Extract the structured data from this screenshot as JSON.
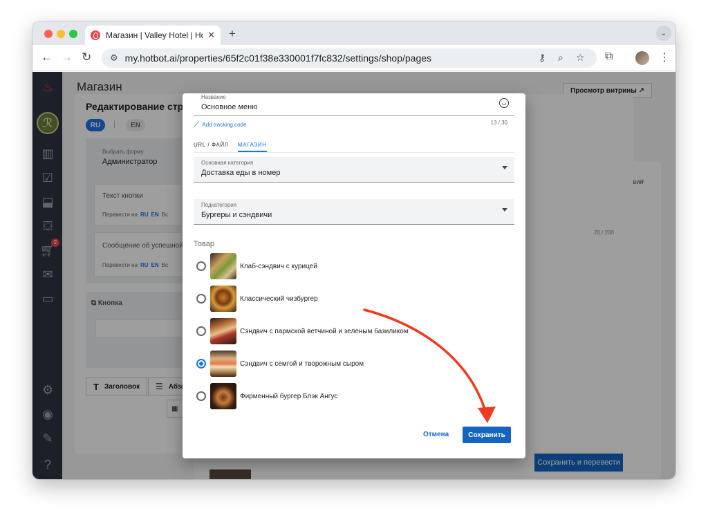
{
  "browser": {
    "tab_title": "Магазин | Valley Hotel | Hotbot",
    "url": "my.hotbot.ai/properties/65f2c01f38e330001f7fc832/settings/shop/pages",
    "accent": "#1a73e8"
  },
  "page": {
    "title": "Магазин",
    "preview_button": "Просмотр витрины ↗"
  },
  "sidebar": {
    "cart_badge": "2",
    "icons": [
      "hotbot-logo-icon",
      "valley-hotel-icon",
      "analytics-icon",
      "tasks-icon",
      "inbox-icon",
      "concierge-icon",
      "cart-icon",
      "mail-icon",
      "chat-icon",
      "settings-icon",
      "profile-icon",
      "edit-icon",
      "help-icon"
    ]
  },
  "edit_panel": {
    "title": "Редактирование стра",
    "lang_ru": "RU",
    "lang_en": "EN",
    "form_select_label": "Выбрать форму",
    "form_select_value": "Администратор",
    "button_text_label": "Текст кнопки",
    "translate_to": "Перевести на",
    "translate_ru": "RU",
    "translate_en": "EN",
    "translate_more": "Вс",
    "success_message_label": "Сообщение об успешной",
    "button_section_label": "Кнопка",
    "heading_button": "Заголовок",
    "paragraph_button": "Абза",
    "save_translate_button": "Сохранить и перевести"
  },
  "background": {
    "column_label": "ствия",
    "counter": "20 / 200"
  },
  "modal": {
    "name_label": "Название",
    "name_value": "Основное меню",
    "tracking_link": "Add tracking code",
    "char_counter": "13 / 30",
    "tabs": [
      "URL / ФАЙЛ",
      "МАГАЗИН"
    ],
    "active_tab": "МАГАЗИН",
    "main_category_label": "Основная категория",
    "main_category_value": "Доставка еды в номер",
    "subcategory_label": "Подкатегория",
    "subcategory_value": "Бургеры и сэндвичи",
    "product_label": "Товар",
    "products": [
      {
        "name": "Клаб-сэндвич с курицей",
        "selected": false
      },
      {
        "name": "Классический чизбургер",
        "selected": false
      },
      {
        "name": "Сэндвич с пармской ветчиной и зеленым базиликом",
        "selected": false
      },
      {
        "name": "Сэндвич с семгой и творожным сыром",
        "selected": true
      },
      {
        "name": "Фирменный бургер Блэк Ангус",
        "selected": false
      }
    ],
    "cancel_button": "Отмена",
    "save_button": "Сохранить"
  }
}
